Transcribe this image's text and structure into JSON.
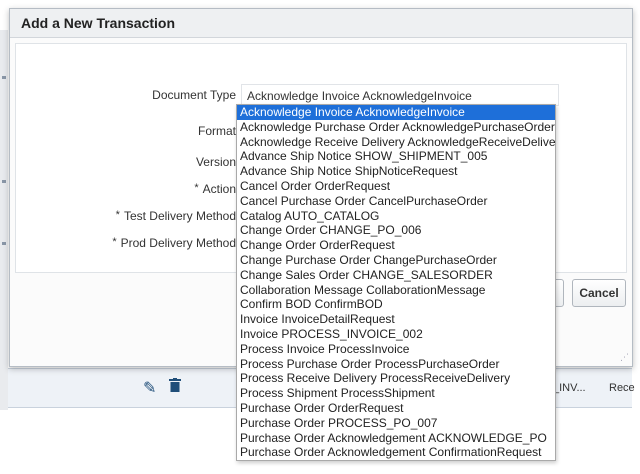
{
  "dialog": {
    "title": "Add a New Transaction",
    "fields": {
      "document_type": "Document Type",
      "format": "Format",
      "version": "Version",
      "action": "Action",
      "test_delivery_method": "Test Delivery Method",
      "prod_delivery_method": "Prod Delivery Method"
    },
    "required_marker": "*",
    "document_type_value": "Acknowledge Invoice AcknowledgeInvoice",
    "cancel_label": "Cancel"
  },
  "grid": {
    "cell_1": "_INV...",
    "cell_2": "Rece"
  },
  "dropdown": {
    "selected_index": 0,
    "options": [
      "Acknowledge Invoice AcknowledgeInvoice",
      "Acknowledge Purchase Order AcknowledgePurchaseOrder",
      "Acknowledge Receive Delivery AcknowledgeReceiveDelivery",
      "Advance Ship Notice SHOW_SHIPMENT_005",
      "Advance Ship Notice ShipNoticeRequest",
      "Cancel Order OrderRequest",
      "Cancel Purchase Order CancelPurchaseOrder",
      "Catalog AUTO_CATALOG",
      "Change Order CHANGE_PO_006",
      "Change Order OrderRequest",
      "Change Purchase Order ChangePurchaseOrder",
      "Change Sales Order CHANGE_SALESORDER",
      "Collaboration Message CollaborationMessage",
      "Confirm BOD ConfirmBOD",
      "Invoice InvoiceDetailRequest",
      "Invoice PROCESS_INVOICE_002",
      "Process Invoice ProcessInvoice",
      "Process Purchase Order ProcessPurchaseOrder",
      "Process Receive Delivery ProcessReceiveDelivery",
      "Process Shipment ProcessShipment",
      "Purchase Order OrderRequest",
      "Purchase Order PROCESS_PO_007",
      "Purchase Order Acknowledgement ACKNOWLEDGE_PO",
      "Purchase Order Acknowledgement ConfirmationRequest"
    ]
  },
  "icons": {
    "edit": "pencil-icon",
    "delete": "trash-icon"
  },
  "colors": {
    "selection": "#1e6fd9",
    "action_icon": "#1f4e79"
  }
}
